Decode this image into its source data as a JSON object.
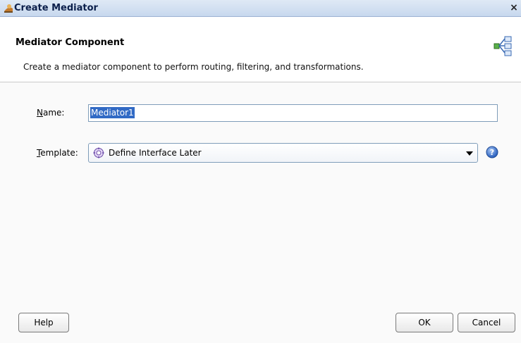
{
  "window": {
    "title": "Create Mediator",
    "close_label": "×"
  },
  "header": {
    "title": "Mediator Component",
    "description": "Create a mediator component to perform routing, filtering, and transformations.",
    "graphic_icon": "routing-diagram-icon"
  },
  "form": {
    "name_label": "Name:",
    "name_mnemonic": "N",
    "name_rest": "ame:",
    "name_value": "Mediator1",
    "template_label": "Template:",
    "template_mnemonic": "T",
    "template_rest": "emplate:",
    "template_value": "Define Interface Later",
    "template_icon": "gear-icon",
    "help_icon": "help-icon"
  },
  "buttons": {
    "help": "Help",
    "ok": "OK",
    "cancel": "Cancel"
  },
  "colors": {
    "selection": "#316ac5",
    "titlebar": "#c7d8ee",
    "title_text": "#0b1f4b"
  }
}
